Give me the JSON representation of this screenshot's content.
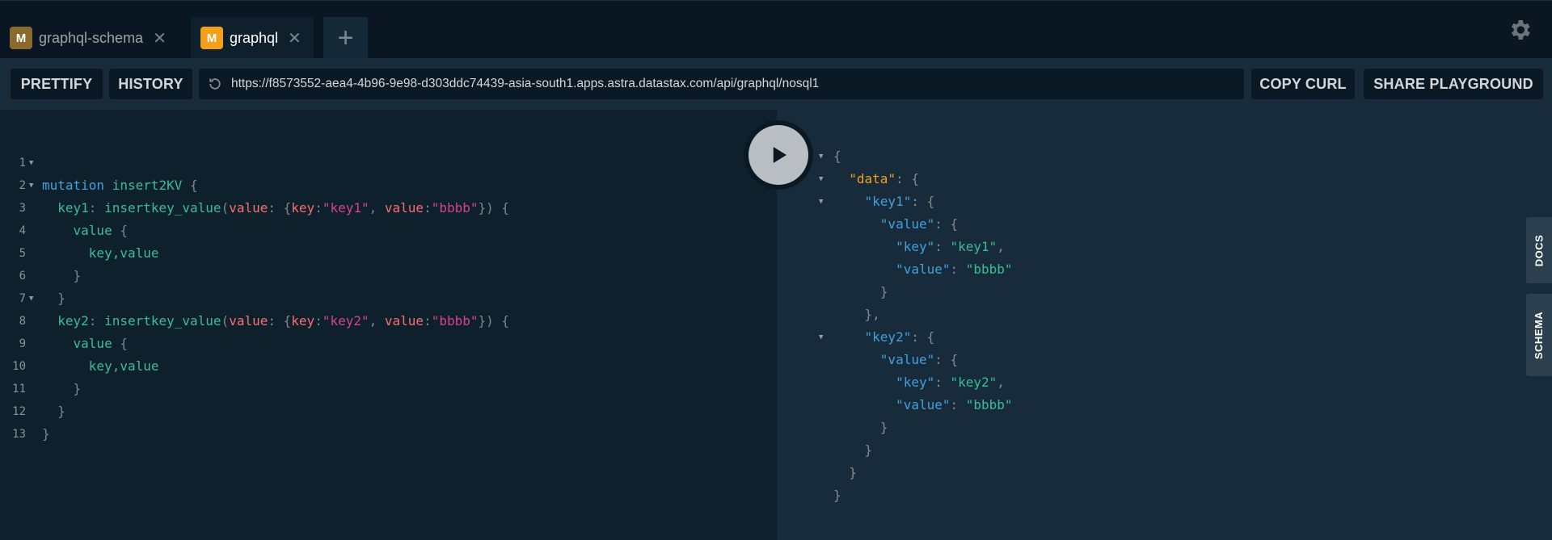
{
  "tabs": [
    {
      "badge": "M",
      "label": "graphql-schema",
      "badge_color": "#8a6b2e",
      "active": false
    },
    {
      "badge": "M",
      "label": "graphql",
      "badge_color": "#f3a01a",
      "active": true
    }
  ],
  "add_tab_label": "+",
  "toolbar": {
    "prettify_label": "PRETTIFY",
    "history_label": "HISTORY",
    "url": "https://f8573552-aea4-4b96-9e98-d303ddc74439-asia-south1.apps.astra.datastax.com/api/graphql/nosql1",
    "copy_curl_label": "COPY CURL",
    "share_label": "SHARE PLAYGROUND"
  },
  "query": {
    "line_numbers": [
      "1",
      "2",
      "3",
      "4",
      "5",
      "6",
      "7",
      "8",
      "9",
      "10",
      "11",
      "12",
      "13"
    ],
    "mutation_keyword": "mutation",
    "mutation_name": "insert2KV",
    "alias1": "key1",
    "alias2": "key2",
    "field_name": "insertkey_value",
    "arg_value": "value",
    "arg_key": "key",
    "key1_str": "\"key1\"",
    "key2_str": "\"key2\"",
    "bbbb_str": "\"bbbb\"",
    "sel_value": "value",
    "sel_fields": "key,value"
  },
  "result": {
    "data_key": "\"data\"",
    "key1": "\"key1\"",
    "key2": "\"key2\"",
    "value_key": "\"value\"",
    "key_key": "\"key\"",
    "key1_val": "\"key1\"",
    "key2_val": "\"key2\"",
    "bbbb_val": "\"bbbb\""
  },
  "side_tabs": {
    "docs": "DOCS",
    "schema": "SCHEMA"
  },
  "colors": {
    "keyword": "#42a0dd",
    "field": "#37bd9c",
    "arg": "#f76f6f",
    "string": "#d64292",
    "data_key": "#f3a01a"
  }
}
